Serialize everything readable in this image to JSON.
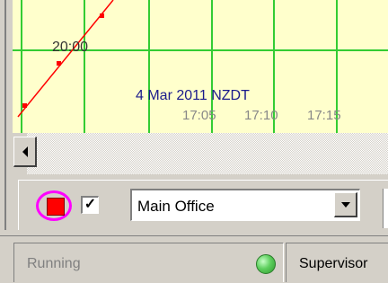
{
  "chart": {
    "y_tick_label": "20:00",
    "date_label": "4 Mar 2011 NZDT",
    "x_ticks": [
      "17:05",
      "17:10",
      "17:15"
    ],
    "colors": {
      "background": "#ffffcc",
      "grid": "#33cc33",
      "series": "#ff0000"
    }
  },
  "toolbar": {
    "color_swatch": "#ff0000",
    "checkbox_checked": true,
    "checkbox_glyph": "✓",
    "location_select": {
      "value": "Main Office"
    }
  },
  "status": {
    "state_text": "Running",
    "indicator_color": "green",
    "user_text": "Supervisor"
  }
}
